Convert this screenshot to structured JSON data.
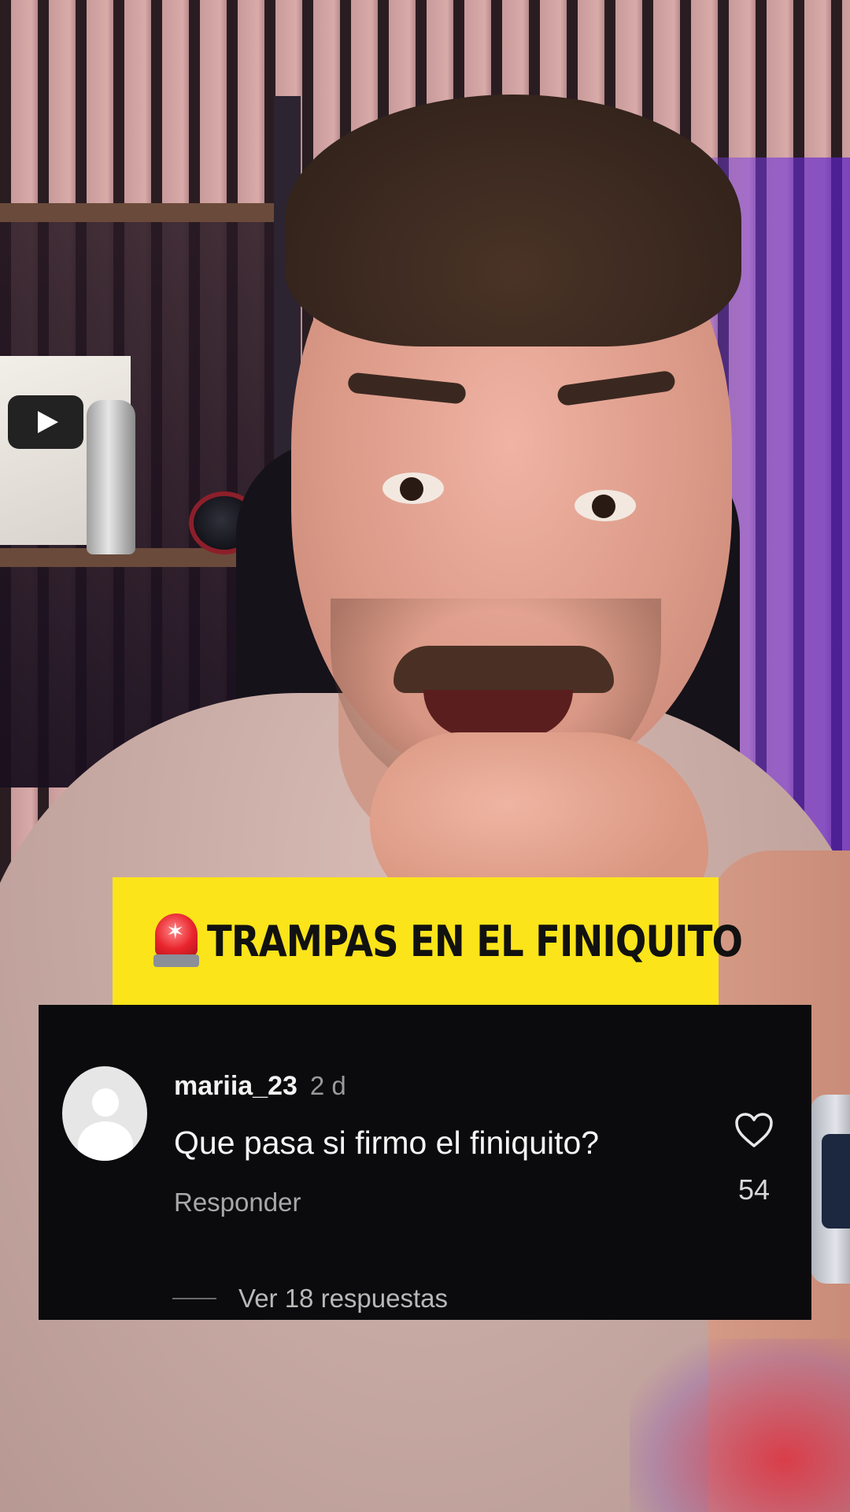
{
  "banner": {
    "icon": "siren-icon",
    "title": "TRAMPAS EN EL FINIQUITO",
    "background_color": "#fbe41a"
  },
  "comment": {
    "username": "mariia_23",
    "time": "2 d",
    "text": "Que pasa si firmo el finiquito?",
    "reply_label": "Responder",
    "like_count": "54",
    "view_replies_label": "Ver 18 respuestas",
    "card_color": "#0b0b0d"
  }
}
